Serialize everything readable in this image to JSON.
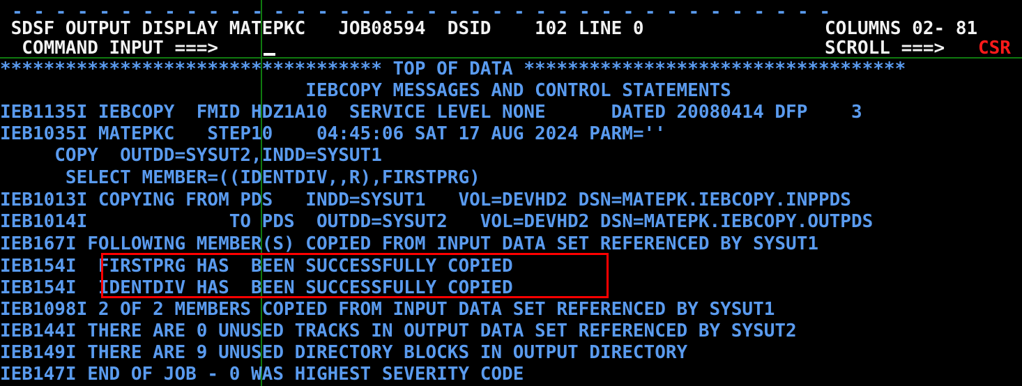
{
  "terminal": {
    "app": "SDSF OUTPUT DISPLAY",
    "colors": {
      "background": "#000000",
      "output_text": "#5a9bef",
      "header_text": "#f2f2f2",
      "attention_text": "#ff1a1a",
      "field_line": "#0f7a0f",
      "annotation_box": "#ff0000"
    }
  },
  "header": {
    "separator_dashes": "- - - - - - - - - - - - - - - - - - - - - - - - - - - - - - - - - - - - - -",
    "title_line_left": " SDSF OUTPUT DISPLAY MATEPKC   JOB08594  DSID    102 LINE 0",
    "title_line_right": "COLUMNS 02- 81",
    "command_label": "  COMMAND INPUT ===>",
    "command_value": "",
    "scroll_label": "SCROLL ===>",
    "scroll_value": "CSR"
  },
  "output": {
    "top_of_data_banner": "*********************************** TOP OF DATA ***********************************",
    "lines": [
      "                            IEBCOPY MESSAGES AND CONTROL STATEMENTS",
      "IEB1135I IEBCOPY  FMID HDZ1A10  SERVICE LEVEL NONE      DATED 20080414 DFP    3",
      "IEB1035I MATEPKC   STEP10    04:45:06 SAT 17 AUG 2024 PARM=''",
      "     COPY  OUTDD=SYSUT2,INDD=SYSUT1",
      "      SELECT MEMBER=((IDENTDIV,,R),FIRSTPRG)",
      "IEB1013I COPYING FROM PDS   INDD=SYSUT1   VOL=DEVHD2 DSN=MATEPK.IEBCOPY.INPPDS",
      "IEB1014I             TO PDS  OUTDD=SYSUT2   VOL=DEVHD2 DSN=MATEPK.IEBCOPY.OUTPDS",
      "IEB167I FOLLOWING MEMBER(S) COPIED FROM INPUT DATA SET REFERENCED BY SYSUT1",
      "IEB154I  FIRSTPRG HAS  BEEN SUCCESSFULLY COPIED",
      "IEB154I  IDENTDIV HAS  BEEN SUCCESSFULLY COPIED",
      "IEB1098I 2 OF 2 MEMBERS COPIED FROM INPUT DATA SET REFERENCED BY SYSUT1",
      "IEB144I THERE ARE 0 UNUSED TRACKS IN OUTPUT DATA SET REFERENCED BY SYSUT2",
      "IEB149I THERE ARE 9 UNUSED DIRECTORY BLOCKS IN OUTPUT DIRECTORY",
      "IEB147I END OF JOB - 0 WAS HIGHEST SEVERITY CODE"
    ]
  },
  "annotation": {
    "label": "copied-members-highlight"
  }
}
